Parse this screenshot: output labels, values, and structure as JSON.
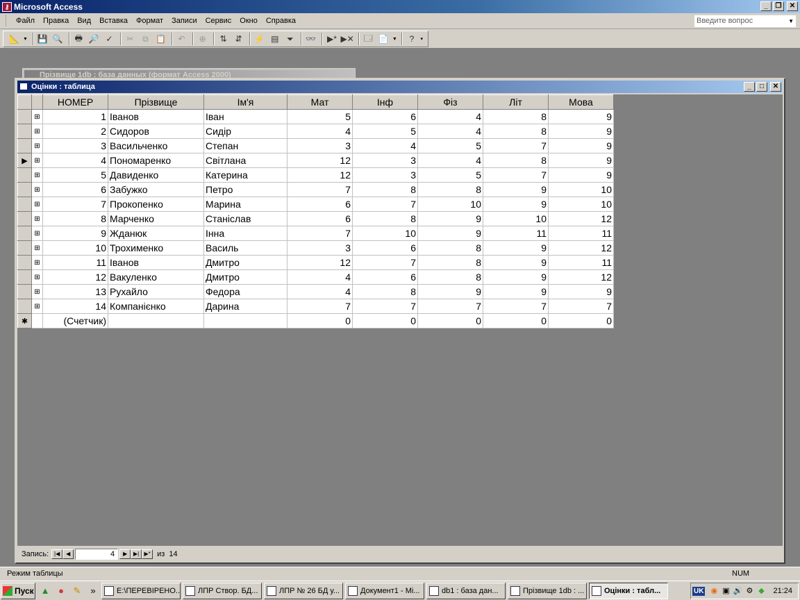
{
  "app": {
    "title": "Microsoft Access",
    "help_placeholder": "Введите вопрос"
  },
  "menu": [
    "Файл",
    "Правка",
    "Вид",
    "Вставка",
    "Формат",
    "Записи",
    "Сервис",
    "Окно",
    "Справка"
  ],
  "background_window": {
    "title": "Прізвище 1db : база данных (формат Access 2000)"
  },
  "table_window": {
    "title": "Оцінки : таблица",
    "columns": [
      "НОМЕР",
      "Прізвище",
      "Ім'я",
      "Мат",
      "Інф",
      "Фіз",
      "Літ",
      "Мова"
    ],
    "rows": [
      {
        "id": "1",
        "surname": "Іванов",
        "name": "Іван",
        "mat": "5",
        "inf": "6",
        "fiz": "4",
        "lit": "8",
        "mova": "9"
      },
      {
        "id": "2",
        "surname": "Сидоров",
        "name": "Сидір",
        "mat": "4",
        "inf": "5",
        "fiz": "4",
        "lit": "8",
        "mova": "9"
      },
      {
        "id": "3",
        "surname": "Васильченко",
        "name": "Степан",
        "mat": "3",
        "inf": "4",
        "fiz": "5",
        "lit": "7",
        "mova": "9"
      },
      {
        "id": "4",
        "surname": "Пономаренко",
        "name": "Світлана",
        "mat": "12",
        "inf": "3",
        "fiz": "4",
        "lit": "8",
        "mova": "9"
      },
      {
        "id": "5",
        "surname": "Давиденко",
        "name": "Катерина",
        "mat": "12",
        "inf": "3",
        "fiz": "5",
        "lit": "7",
        "mova": "9"
      },
      {
        "id": "6",
        "surname": "Забужко",
        "name": "Петро",
        "mat": "7",
        "inf": "8",
        "fiz": "8",
        "lit": "9",
        "mova": "10"
      },
      {
        "id": "7",
        "surname": "Прокопенко",
        "name": "Марина",
        "mat": "6",
        "inf": "7",
        "fiz": "10",
        "lit": "9",
        "mova": "10"
      },
      {
        "id": "8",
        "surname": "Марченко",
        "name": "Станіслав",
        "mat": "6",
        "inf": "8",
        "fiz": "9",
        "lit": "10",
        "mova": "12"
      },
      {
        "id": "9",
        "surname": "Жданюк",
        "name": "Інна",
        "mat": "7",
        "inf": "10",
        "fiz": "9",
        "lit": "11",
        "mova": "11"
      },
      {
        "id": "10",
        "surname": "Трохименко",
        "name": "Василь",
        "mat": "3",
        "inf": "6",
        "fiz": "8",
        "lit": "9",
        "mova": "12"
      },
      {
        "id": "11",
        "surname": "Іванов",
        "name": "Дмитро",
        "mat": "12",
        "inf": "7",
        "fiz": "8",
        "lit": "9",
        "mova": "11"
      },
      {
        "id": "12",
        "surname": "Вакуленко",
        "name": "Дмитро",
        "mat": "4",
        "inf": "6",
        "fiz": "8",
        "lit": "9",
        "mova": "12"
      },
      {
        "id": "13",
        "surname": "Рухайло",
        "name": "Федора",
        "mat": "4",
        "inf": "8",
        "fiz": "9",
        "lit": "9",
        "mova": "9"
      },
      {
        "id": "14",
        "surname": "Компанієнко",
        "name": "Дарина",
        "mat": "7",
        "inf": "7",
        "fiz": "7",
        "lit": "7",
        "mova": "7"
      }
    ],
    "new_row": {
      "id": "(Счетчик)",
      "mat": "0",
      "inf": "0",
      "fiz": "0",
      "lit": "0",
      "mova": "0"
    },
    "current_row_index": 3,
    "navigator": {
      "label": "Запись:",
      "current": "4",
      "of_label": "из",
      "total": "14"
    }
  },
  "status": {
    "text": "Режим таблицы",
    "num": "NUM"
  },
  "taskbar": {
    "start": "Пуск",
    "tasks": [
      {
        "label": "E:\\ПЕРЕВІРЕНО...",
        "active": false
      },
      {
        "label": "ЛПР Створ. БД...",
        "active": false
      },
      {
        "label": "ЛПР № 26 БД у...",
        "active": false
      },
      {
        "label": "Документ1 - Mi...",
        "active": false
      },
      {
        "label": "db1 : база дан...",
        "active": false
      },
      {
        "label": "Прізвище 1db : ...",
        "active": false
      },
      {
        "label": "Оцінки : табл...",
        "active": true
      }
    ],
    "lang": "UK",
    "clock": "21:24"
  },
  "colors": {
    "title_active": "#0a246a",
    "face": "#d4d0c8",
    "workspace": "#808080"
  }
}
